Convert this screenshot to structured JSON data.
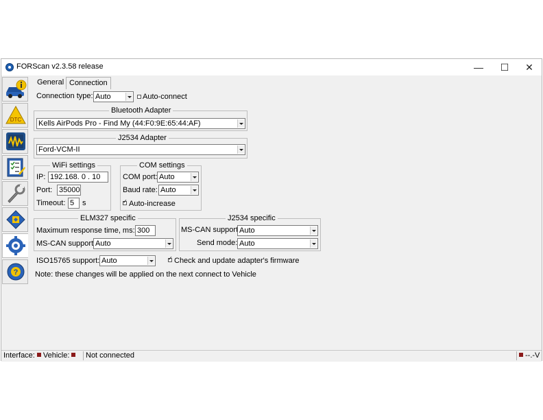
{
  "window": {
    "title": "FORScan v2.3.58 release",
    "minimize": "—",
    "maximize": "☐",
    "close": "✕"
  },
  "tabs": [
    {
      "label": "General"
    },
    {
      "label": "Connection"
    }
  ],
  "connection": {
    "type_label": "Connection type:",
    "type_value": "Auto",
    "auto_connect_label": "Auto-connect",
    "auto_connect_checked": false
  },
  "bluetooth": {
    "title": "Bluetooth Adapter",
    "value": "Kells AirPods Pro - Find My (44:F0:9E:65:44:AF)"
  },
  "j2534_adapter": {
    "title": "J2534 Adapter",
    "value": "Ford-VCM-II"
  },
  "wifi": {
    "title": "WiFi settings",
    "ip_label": "IP:",
    "ip_value": "192.168.  0  . 10",
    "port_label": "Port:",
    "port_value": "35000",
    "timeout_label": "Timeout:",
    "timeout_value": "5",
    "timeout_unit": "s"
  },
  "com": {
    "title": "COM settings",
    "port_label": "COM port:",
    "port_value": "Auto",
    "baud_label": "Baud rate:",
    "baud_value": "Auto",
    "auto_increase_label": "Auto-increase",
    "auto_increase_checked": true
  },
  "elm327": {
    "title": "ELM327 specific",
    "max_response_label": "Maximum response time, ms:",
    "max_response_value": "300",
    "mscan_label": "MS-CAN support:",
    "mscan_value": "Auto"
  },
  "j2534_specific": {
    "title": "J2534 specific",
    "mscan_label": "MS-CAN support:",
    "mscan_value": "Auto",
    "send_mode_label": "Send mode:",
    "send_mode_value": "Auto"
  },
  "iso15765": {
    "label": "ISO15765 support:",
    "value": "Auto"
  },
  "firmware": {
    "label": "Check and update adapter's firmware",
    "checked": true
  },
  "note": "Note: these changes will be applied on the next connect to Vehicle",
  "status": {
    "interface_label": "Interface:",
    "vehicle_label": "Vehicle:",
    "connection_text": "Not connected",
    "voltage": "--.-V",
    "indicator_color": "#8b1a1a"
  },
  "sidebar": [
    {
      "icon": "vehicle-info-icon"
    },
    {
      "icon": "dtc-icon"
    },
    {
      "icon": "oscilloscope-icon"
    },
    {
      "icon": "checklist-icon"
    },
    {
      "icon": "wrench-icon"
    },
    {
      "icon": "chip-icon"
    },
    {
      "icon": "settings-gear-icon",
      "active": true
    },
    {
      "icon": "help-icon"
    }
  ]
}
